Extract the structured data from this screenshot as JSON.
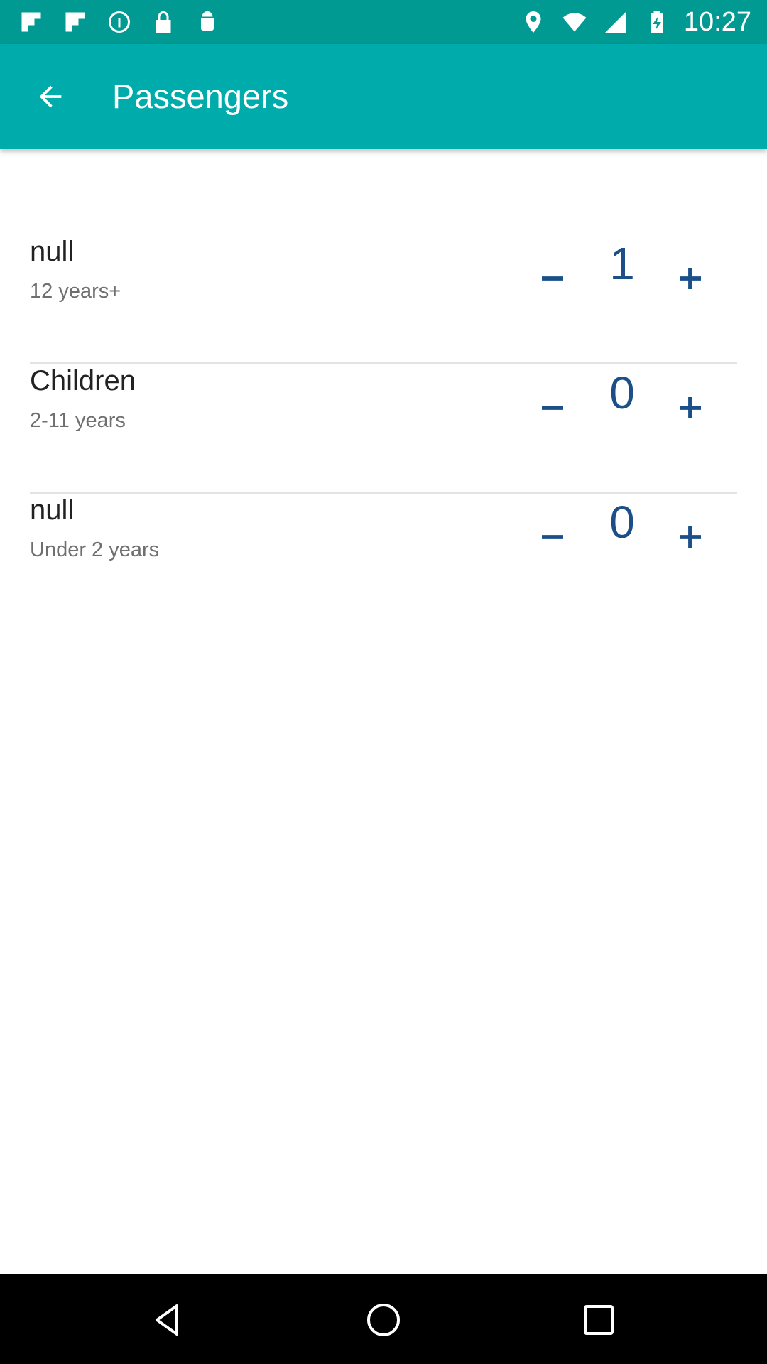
{
  "status_bar": {
    "time": "10:27",
    "left_icons": [
      "flipboard-icon",
      "flipboard-icon",
      "info-circle-icon",
      "lock-icon",
      "android-icon"
    ],
    "right_icons": [
      "location-icon",
      "wifi-icon",
      "signal-icon",
      "battery-charging-icon"
    ]
  },
  "app_bar": {
    "title": "Passengers",
    "background": "#00acab"
  },
  "passengers": [
    {
      "name": "null",
      "subtitle": "12 years+",
      "count": "1"
    },
    {
      "name": "Children",
      "subtitle": "2-11 years",
      "count": "0"
    },
    {
      "name": "null",
      "subtitle": "Under 2 years",
      "count": "0"
    }
  ],
  "colors": {
    "accent": "#1a4f8a",
    "status_bar": "#009a93"
  }
}
